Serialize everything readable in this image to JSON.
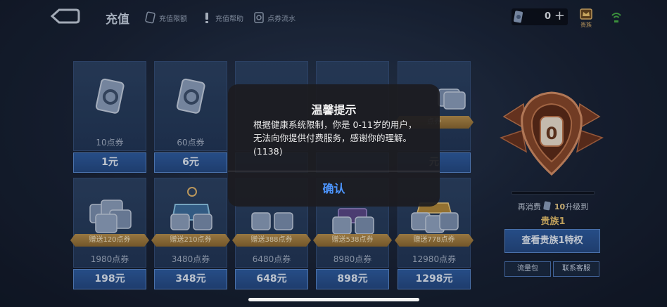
{
  "header": {
    "title": "充值",
    "links": [
      {
        "label": "充值限额",
        "icon": "card-icon"
      },
      {
        "label": "充值帮助",
        "icon": "exclamation-icon"
      },
      {
        "label": "点券流水",
        "icon": "coin-record-icon"
      }
    ],
    "coin_balance": "0",
    "add_label": "+",
    "noble_label": "贵族",
    "colors": {
      "accent_blue": "#2f5ea4",
      "gold": "#e7c16e"
    }
  },
  "cards": [
    {
      "amount": "10点券",
      "price": "1元",
      "bonus": ""
    },
    {
      "amount": "60点券",
      "price": "6元",
      "bonus": ""
    },
    {
      "amount": "",
      "price": "",
      "bonus": ""
    },
    {
      "amount": "",
      "price": "",
      "bonus": ""
    },
    {
      "amount": "",
      "price": "元",
      "bonus": "点券"
    },
    {
      "amount": "1980点券",
      "price": "198元",
      "bonus": "赠送120点券"
    },
    {
      "amount": "3480点券",
      "price": "348元",
      "bonus": "赠送210点券"
    },
    {
      "amount": "6480点券",
      "price": "648元",
      "bonus": "赠送388点券"
    },
    {
      "amount": "8980点券",
      "price": "898元",
      "bonus": "赠送538点券"
    },
    {
      "amount": "12980点券",
      "price": "1298元",
      "bonus": "赠送778点券"
    }
  ],
  "noble": {
    "level": "0",
    "upgrade_prefix": "再消费",
    "upgrade_amount": "10",
    "upgrade_suffix": "升级到",
    "next_level": "贵族1",
    "view_button": "查看贵族1特权",
    "progress": 0
  },
  "bottom_buttons": {
    "data_pack": "流量包",
    "contact": "联系客服"
  },
  "dialog": {
    "title": "温馨提示",
    "message": "根据健康系统限制，你是 0-11岁的用户，无法向你提供付费服务，感谢你的理解。(1138)",
    "confirm": "确认"
  }
}
